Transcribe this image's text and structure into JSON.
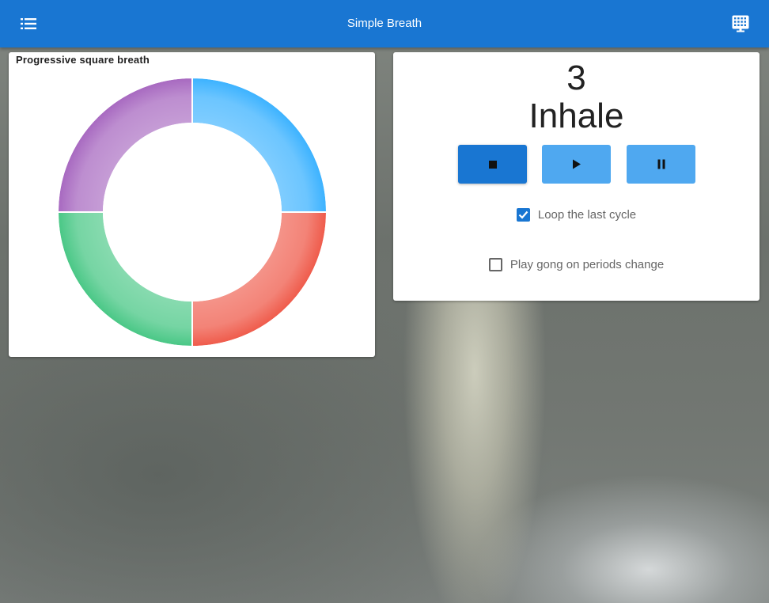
{
  "app": {
    "title": "Simple Breath",
    "menu_icon": "list-icon",
    "grid_icon": "keypad-grid-icon",
    "bar_color": "#1976d2"
  },
  "chart_card": {
    "title": "Progressive square breath"
  },
  "chart_data": {
    "type": "pie",
    "title": "Progressive square breath",
    "donut": true,
    "categories": [
      "",
      "",
      "",
      ""
    ],
    "values": [
      25,
      25,
      25,
      25
    ],
    "colors": [
      "#3bb2ff",
      "#ef5a4a",
      "#48c785",
      "#a768c0"
    ]
  },
  "breath": {
    "count": "3",
    "phase": "Inhale"
  },
  "controls": {
    "stop_icon": "stop-icon",
    "play_icon": "play-icon",
    "pause_icon": "pause-icon"
  },
  "options": {
    "loop_label": "Loop the last cycle",
    "loop_checked": true,
    "gong_label": "Play gong on periods change",
    "gong_checked": false
  }
}
